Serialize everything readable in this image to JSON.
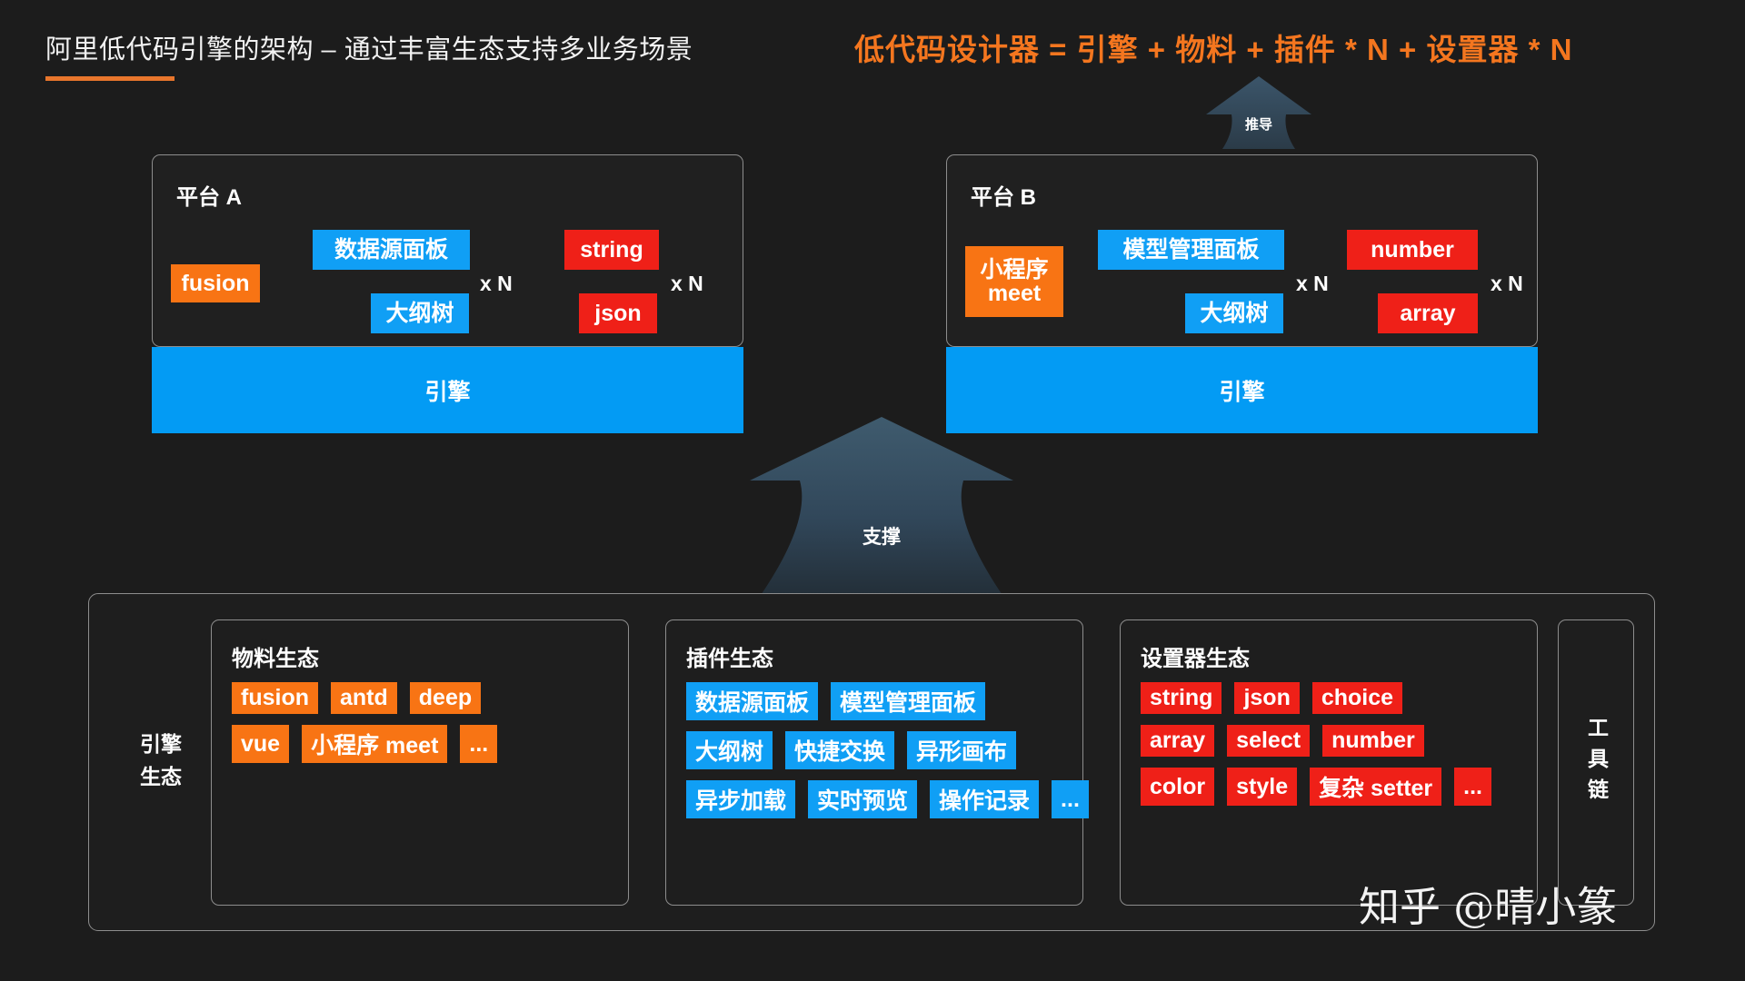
{
  "header": {
    "title": "阿里低代码引擎的架构 – 通过丰富生态支持多业务场景",
    "formula": "低代码设计器 = 引擎 + 物料 + 插件 * N + 设置器 * N",
    "accent_color": "#e8762c",
    "formula_color": "#f4761f"
  },
  "arrows": {
    "derive": {
      "label": "推导"
    },
    "support": {
      "label": "支撑"
    }
  },
  "platforms": [
    {
      "title": "平台 A",
      "engine_label": "引擎",
      "material": {
        "label": "fusion",
        "color": "#f87414"
      },
      "plugins": [
        {
          "label": "数据源面板",
          "color": "#109ff5"
        },
        {
          "label": "大纲树",
          "color": "#109ff5"
        }
      ],
      "plugin_multiplier": "x N",
      "setters": [
        {
          "label": "string",
          "color": "#ef2018"
        },
        {
          "label": "json",
          "color": "#ef2018"
        }
      ],
      "setter_multiplier": "x N"
    },
    {
      "title": "平台 B",
      "engine_label": "引擎",
      "material": {
        "label_line1": "小程序",
        "label_line2": "meet",
        "color": "#f87414"
      },
      "plugins": [
        {
          "label": "模型管理面板",
          "color": "#109ff5"
        },
        {
          "label": "大纲树",
          "color": "#109ff5"
        }
      ],
      "plugin_multiplier": "x N",
      "setters": [
        {
          "label": "number",
          "color": "#ef2018"
        },
        {
          "label": "array",
          "color": "#ef2018"
        }
      ],
      "setter_multiplier": "x N"
    }
  ],
  "ecosystem": {
    "left_label_line1": "引擎",
    "left_label_line2": "生态",
    "boxes": [
      {
        "title": "物料生态",
        "color": "#f87414",
        "rows": [
          [
            "fusion",
            "antd",
            "deep"
          ],
          [
            "vue",
            "小程序 meet",
            "..."
          ]
        ]
      },
      {
        "title": "插件生态",
        "color": "#109ff5",
        "rows": [
          [
            "数据源面板",
            "模型管理面板"
          ],
          [
            "大纲树",
            "快捷交换",
            "异形画布"
          ],
          [
            "异步加载",
            "实时预览",
            "操作记录",
            "..."
          ]
        ]
      },
      {
        "title": "设置器生态",
        "color": "#ef2018",
        "rows": [
          [
            "string",
            "json",
            "choice"
          ],
          [
            "array",
            "select",
            "number"
          ],
          [
            "color",
            "style",
            "复杂 setter",
            "..."
          ]
        ]
      }
    ],
    "toolchain": {
      "label": "工具链"
    }
  },
  "watermark": {
    "text": "知乎 @晴小篆"
  }
}
